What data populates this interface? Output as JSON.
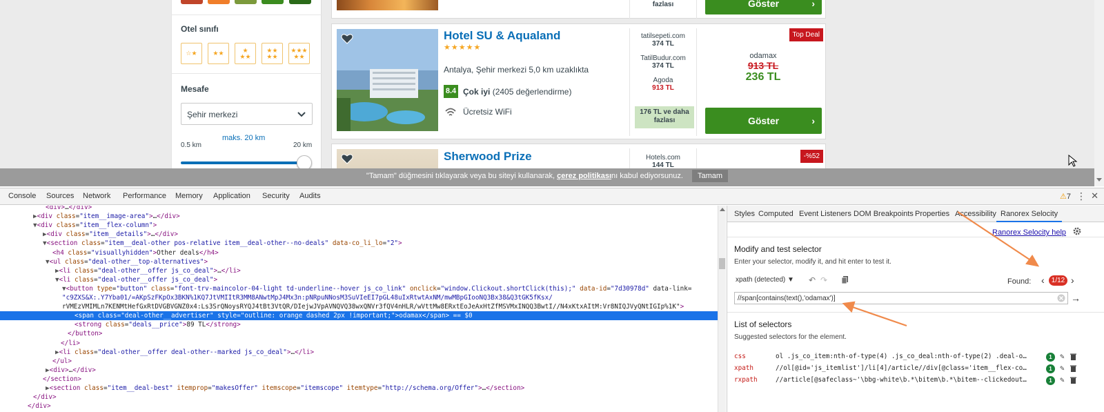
{
  "filters": {
    "hotel_class_title": "Otel sınıfı",
    "distance_title": "Mesafe",
    "distance_select": "Şehir merkezi",
    "max_distance_label": "maks. 20 km",
    "range_min": "0.5 km",
    "range_max": "20 km",
    "star_options": [
      "1 star",
      "2 stars",
      "3 stars",
      "4 stars",
      "5 stars"
    ],
    "swatch_colors": [
      "#c0452a",
      "#f07e2a",
      "#7c9a3c",
      "#3b8c1f",
      "#2a6a18"
    ]
  },
  "partial_card": {
    "fazla_label": "fazlası",
    "show_button": "Göster"
  },
  "hotel": {
    "name": "Hotel SU & Aqualand",
    "stars": "★★★★★",
    "location": "Antalya, Şehir merkezi 5,0 km uzaklıkta",
    "rating": "8.4",
    "rating_word": "Çok iyi",
    "rating_count": "(2405 değerlendirme)",
    "amenity": "Ücretsiz WiFi",
    "badge": "Top Deal",
    "alternatives": [
      {
        "site": "tatilsepeti.com",
        "price": "374 TL"
      },
      {
        "site": "TatilBudur.com",
        "price": "374 TL"
      },
      {
        "site": "Agoda",
        "price": "913 TL"
      }
    ],
    "more_offers": "176 TL ve daha fazlası",
    "best_site": "odamax",
    "best_old_price": "913 TL",
    "best_price": "236 TL",
    "show_button": "Göster"
  },
  "hotel2": {
    "name": "Sherwood Prize",
    "alt_site": "Hotels.com",
    "alt_price": "144 TL",
    "badge": "-%52"
  },
  "cookie": {
    "text": "\"Tamam\" düğmesini tıklayarak veya bu siteyi kullanarak, ",
    "policy": "çerez politikası",
    "text_after": "nı kabul ediyorsunuz.",
    "button": "Tamam"
  },
  "devtools": {
    "tabs": [
      "Console",
      "Sources",
      "Network",
      "Performance",
      "Memory",
      "Application",
      "Security",
      "Audits"
    ],
    "warnings": "7",
    "side_tabs": [
      "Styles",
      "Computed",
      "Event Listeners",
      "DOM Breakpoints",
      "Properties",
      "Accessibility"
    ],
    "active_side_tab": "Ranorex Selocity",
    "help_link": "Ranorex Selocity help",
    "modify_title": "Modify and test selector",
    "modify_sub": "Enter your selector, modify it, and hit enter to test it.",
    "selector_type": "xpath (detected) ▼",
    "found_label": "Found:",
    "found_badge": "1/12",
    "selector_value": "//span[contains(text(),'odamax')]",
    "list_title": "List of selectors",
    "list_sub": "Suggested selectors for the element.",
    "selectors": [
      {
        "type": "css",
        "value": "ol .js_co_item:nth-of-type(4) .js_co_deal:nth-of-type(2) .deal-o…",
        "count": "1"
      },
      {
        "type": "xpath",
        "value": "//ol[@id='js_itemlist']/li[4]/article//div[@class='item__flex-co…",
        "count": "1"
      },
      {
        "type": "rxpath",
        "value": "//article[@safeclass~'\\bbg-white\\b.*\\bitem\\b.*\\bitem--clickedout…",
        "count": "1"
      }
    ],
    "dom_lines": [
      "<div>…</div>",
      "▶<div class=\"item__image-area\">…</div>",
      "▼<div class=\"item__flex-column\">",
      "▶<div class=\"item__details\">…</div>",
      "▼<section class=\"item__deal-other pos-relative item__deal-other--no-deals\" data-co_li_lo=\"2\">",
      "<h4 class=\"visuallyhidden\">Other deals</h4>",
      "▼<ul class=\"deal-other__top-alternatives\">",
      "▶<li class=\"deal-other__offer js_co_deal\">…</li>",
      "▼<li class=\"deal-other__offer js_co_deal\">",
      "▼<button type=\"button\" class=\"font-trv-maincolor-04-light td-underline--hover js_co_link\" onclick=\"window.Clickout.shortClick(this);\" data-id=\"7d30978d\" data-link=",
      "\"c9ZXS&X:.Y7Yba01/=AKpSzFKpOx3BKN%1KQ7JtVMIItR3MM8ANwtMpJ4Mx3n:pNRpuNNosM3SuVIeEI7pGL48uIxRtwtAxNM/mwMBpGIooNQ3Bx38&Q3tGK5fKsx/",
      "rVMEzVMIMLn7KENMtHefGxRtDVGBVGNZ0x4:Ls3SrQNoysRYQJ4tBt3VtQR/DIejwJVpAVNQVQ38wxQNVr3fQV4nHLR/wVttMw8ERxtEoJeAxHtZfMSVMxINQQ3BwtI//N4xKtxAItM:Vr8NIQJVyQNtIGIp%1K\">",
      "<span class=\"deal-other__advertiser\" style=\"outline: orange dashed 2px !important;\">odamax</span> == $0",
      "<strong class=\"deals__price\">89 TL</strong>",
      "</button>",
      "</li>",
      "▶<li class=\"deal-other__offer deal-other--marked js_co_deal\">…</li>",
      "</ul>",
      "▶<div>…</div>",
      "</section>",
      "▶<section class=\"item__deal-best\" itemprop=\"makesOffer\" itemscope=\"itemscope\" itemtype=\"http://schema.org/Offer\">…</section>",
      "</div>",
      "</div>"
    ]
  }
}
